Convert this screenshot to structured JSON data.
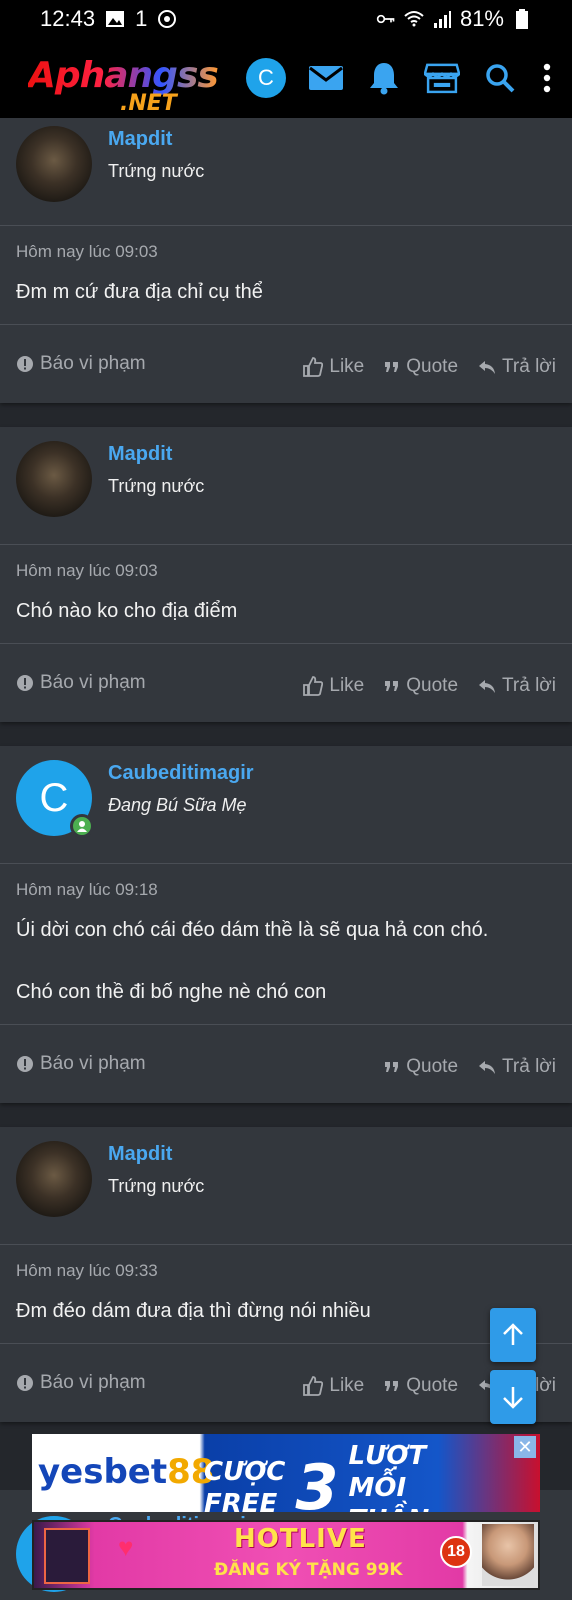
{
  "status_bar": {
    "time": "12:43",
    "indicator": "1",
    "battery": "81%"
  },
  "header": {
    "logo_main": "Aphangss",
    "logo_sub": ".NET",
    "avatar_letter": "C"
  },
  "posts": [
    {
      "user": {
        "name": "Mapdit",
        "title": "Trứng nước",
        "avatar": "photo"
      },
      "time": "Hôm nay lúc 09:03",
      "text": [
        "Đm m cứ đưa địa chỉ cụ thể"
      ],
      "actions": {
        "report": "Báo vi phạm",
        "like": "Like",
        "quote": "Quote",
        "reply": "Trả lời"
      }
    },
    {
      "user": {
        "name": "Mapdit",
        "title": "Trứng nước",
        "avatar": "photo"
      },
      "time": "Hôm nay lúc 09:03",
      "text": [
        "Chó nào ko cho địa điểm"
      ],
      "actions": {
        "report": "Báo vi phạm",
        "like": "Like",
        "quote": "Quote",
        "reply": "Trả lời"
      }
    },
    {
      "user": {
        "name": "Caubeditimagir",
        "title": "Đang Bú Sữa Mẹ",
        "avatar_letter": "C"
      },
      "time": "Hôm nay lúc 09:18",
      "text": [
        "Úi dời con chó cái đéo dám thề là sẽ qua hả con chó.",
        "Chó con thề đi bố nghe nè chó con"
      ],
      "actions": {
        "report": "Báo vi phạm",
        "quote": "Quote",
        "reply": "Trả lời"
      }
    },
    {
      "user": {
        "name": "Mapdit",
        "title": "Trứng nước",
        "avatar": "photo"
      },
      "time": "Hôm nay lúc 09:33",
      "text": [
        "Đm đéo dám đưa địa thì đừng nói nhiều"
      ],
      "actions": {
        "report": "Báo vi phạm",
        "like": "Like",
        "quote": "Quote",
        "reply": "Trả lời"
      }
    }
  ],
  "next_post_peek": {
    "name": "Caubeditimagir"
  },
  "ads": {
    "yesbet": {
      "brand": "yesbet",
      "brand_num": "88",
      "line1": "CƯỢC",
      "line2": "FREE",
      "big": "3",
      "line3": "LƯỢT",
      "line4": "MỖI TUẦN",
      "close": "✕"
    },
    "hotlive": {
      "title": "HOTLIVE",
      "subtitle": "ĐĂNG KÝ TẶNG 99K",
      "age": "18"
    }
  },
  "colors": {
    "accent": "#1fa3ea",
    "username": "#4aa8f0",
    "card": "#33373d",
    "page": "#24272c",
    "online": "#4caf50"
  },
  "icons": [
    "image-icon",
    "sync-icon",
    "key-icon",
    "wifi-icon",
    "signal-icon",
    "battery-icon",
    "mail-icon",
    "bell-icon",
    "store-icon",
    "search-icon",
    "more-vert-icon",
    "alert-icon",
    "thumbs-up-icon",
    "quote-icon",
    "reply-icon",
    "arrow-up-icon",
    "arrow-down-icon",
    "person-icon"
  ]
}
